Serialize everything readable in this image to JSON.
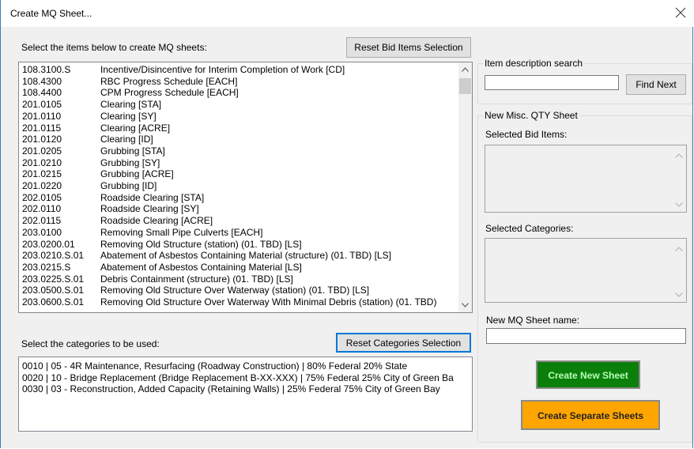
{
  "window": {
    "title": "Create MQ Sheet..."
  },
  "left": {
    "items_label": "Select the items below to create MQ sheets:",
    "reset_items_button": "Reset Bid Items Selection",
    "items": [
      {
        "code": "108.3100.S",
        "desc": "Incentive/Disincentive for Interim Completion of Work  [CD]"
      },
      {
        "code": "108.4300",
        "desc": "RBC Progress Schedule  [EACH]"
      },
      {
        "code": "108.4400",
        "desc": "CPM Progress Schedule  [EACH]"
      },
      {
        "code": "201.0105",
        "desc": "Clearing  [STA]"
      },
      {
        "code": "201.0110",
        "desc": "Clearing  [SY]"
      },
      {
        "code": "201.0115",
        "desc": "Clearing  [ACRE]"
      },
      {
        "code": "201.0120",
        "desc": "Clearing  [ID]"
      },
      {
        "code": "201.0205",
        "desc": "Grubbing  [STA]"
      },
      {
        "code": "201.0210",
        "desc": "Grubbing  [SY]"
      },
      {
        "code": "201.0215",
        "desc": "Grubbing  [ACRE]"
      },
      {
        "code": "201.0220",
        "desc": "Grubbing  [ID]"
      },
      {
        "code": "202.0105",
        "desc": "Roadside Clearing  [STA]"
      },
      {
        "code": "202.0110",
        "desc": "Roadside Clearing  [SY]"
      },
      {
        "code": "202.0115",
        "desc": "Roadside Clearing  [ACRE]"
      },
      {
        "code": "203.0100",
        "desc": "Removing Small Pipe Culverts  [EACH]"
      },
      {
        "code": "203.0200.01",
        "desc": "Removing Old Structure (station) (01. TBD)  [LS]"
      },
      {
        "code": "203.0210.S.01",
        "desc": "Abatement of Asbestos Containing Material (structure) (01. TBD)  [LS]"
      },
      {
        "code": "203.0215.S",
        "desc": "Abatement of Asbestos Containing Material  [LS]"
      },
      {
        "code": "203.0225.S.01",
        "desc": "Debris Containment (structure) (01. TBD)  [LS]"
      },
      {
        "code": "203.0500.S.01",
        "desc": "Removing Old Structure Over Waterway (station) (01. TBD)  [LS]"
      },
      {
        "code": "203.0600.S.01",
        "desc": "Removing Old Structure Over Waterway With Minimal Debris (station) (01. TBD)"
      }
    ],
    "categories_label": "Select the categories to be used:",
    "reset_categories_button": "Reset Categories Selection",
    "categories": [
      "0010 | 05 - 4R Maintenance, Resurfacing (Roadway Construction) | 80% Federal 20% State",
      "0020 | 10 - Bridge Replacement (Bridge Replacement B-XX-XXX) | 75% Federal 25% City of Green Ba",
      "0030 | 03 - Reconstruction, Added Capacity (Retaining Walls) | 25% Federal 75% City of Green Bay"
    ]
  },
  "right": {
    "search_group_label": "Item description search",
    "search_value": "",
    "find_next_button": "Find Next",
    "new_sheet_group_label": "New Misc. QTY Sheet",
    "selected_bid_items_label": "Selected Bid Items:",
    "selected_categories_label": "Selected Categories:",
    "sheet_name_label": "New MQ Sheet name:",
    "sheet_name_value": "",
    "create_new_button": "Create New Sheet",
    "create_separate_button": "Create Separate Sheets"
  },
  "colors": {
    "accent": "#0078d7",
    "green_button": "#0a800a",
    "orange_button": "#ffa500"
  }
}
